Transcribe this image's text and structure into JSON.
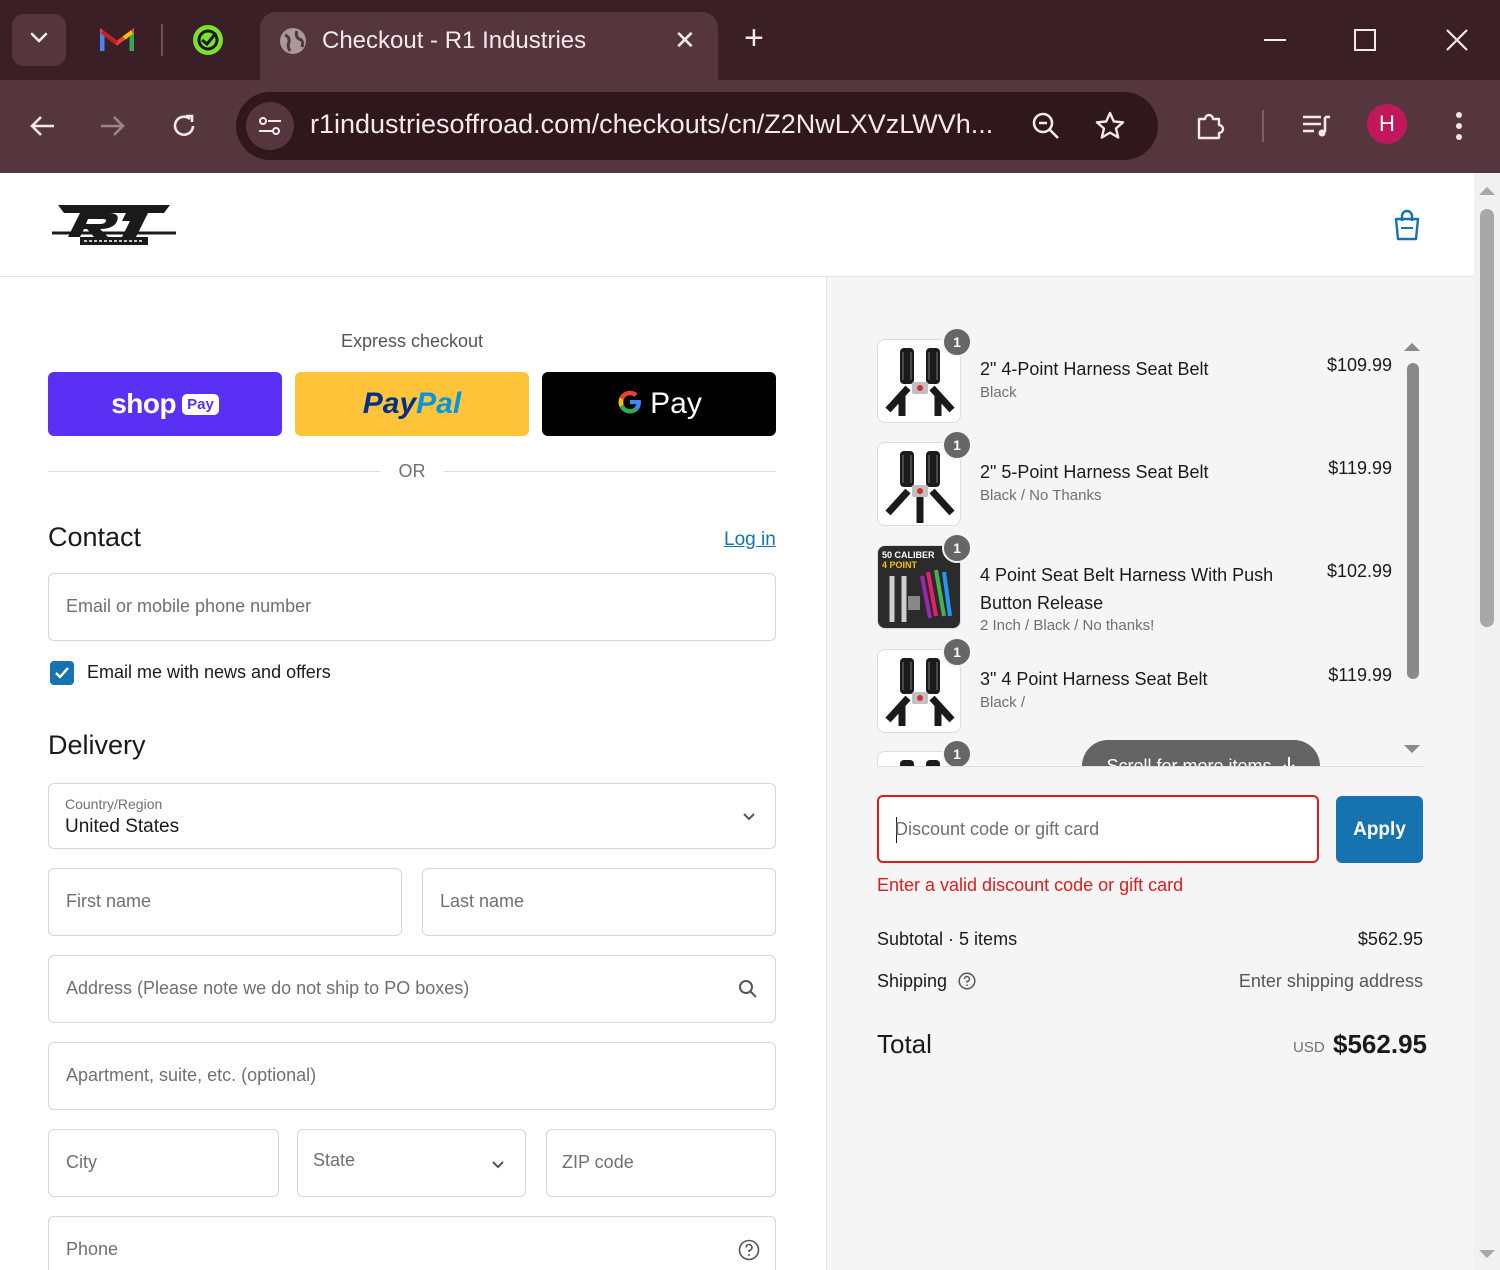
{
  "browser": {
    "tab_title": "Checkout - R1 Industries",
    "url": "r1industriesoffroad.com/checkouts/cn/Z2NwLXVzLWVh...",
    "avatar_initial": "H"
  },
  "colors": {
    "shop_pay": "#5a31f4",
    "paypal": "#ffc439",
    "accent": "#1773b0",
    "error": "#dd1d1d"
  },
  "express": {
    "label": "Express checkout",
    "shop_word": "shop",
    "shop_pill": "Pay",
    "paypal_pay": "Pay",
    "paypal_pal": "Pal",
    "gpay_text": "Pay",
    "or": "OR"
  },
  "contact": {
    "title": "Contact",
    "login": "Log in",
    "email_placeholder": "Email or mobile phone number",
    "newsletter_label": "Email me with news and offers",
    "newsletter_checked": true
  },
  "delivery": {
    "title": "Delivery",
    "country_label": "Country/Region",
    "country_value": "United States",
    "first_name": "First name",
    "last_name": "Last name",
    "address": "Address (Please note we do not ship to PO boxes)",
    "apartment": "Apartment, suite, etc. (optional)",
    "city": "City",
    "state": "State",
    "zip": "ZIP code",
    "phone": "Phone"
  },
  "cart": {
    "items": [
      {
        "name": "2\" 4-Point Harness Seat Belt",
        "variant": "Black",
        "price": "$109.99",
        "qty": "1"
      },
      {
        "name": "2\" 5-Point Harness Seat Belt",
        "variant": "Black / No Thanks",
        "price": "$119.99",
        "qty": "1"
      },
      {
        "name": "4 Point Seat Belt Harness With Push Button Release",
        "variant": "2 Inch / Black / No thanks!",
        "price": "$102.99",
        "qty": "1"
      },
      {
        "name": "3\" 4 Point Harness Seat Belt",
        "variant": "Black / ",
        "price": "$119.99",
        "qty": "1"
      },
      {
        "name": "",
        "variant": "",
        "price": "",
        "qty": "1"
      }
    ],
    "scroll_hint": "Scroll for more items",
    "thumb_label_top": "50 CALIBER",
    "thumb_label_bottom": "4 POINT"
  },
  "discount": {
    "placeholder": "Discount code or gift card",
    "apply": "Apply",
    "error": "Enter a valid discount code or gift card"
  },
  "totals": {
    "subtotal_label": "Subtotal · 5 items",
    "subtotal_value": "$562.95",
    "shipping_label": "Shipping",
    "shipping_value": "Enter shipping address",
    "total_label": "Total",
    "currency": "USD",
    "total_value": "$562.95"
  }
}
